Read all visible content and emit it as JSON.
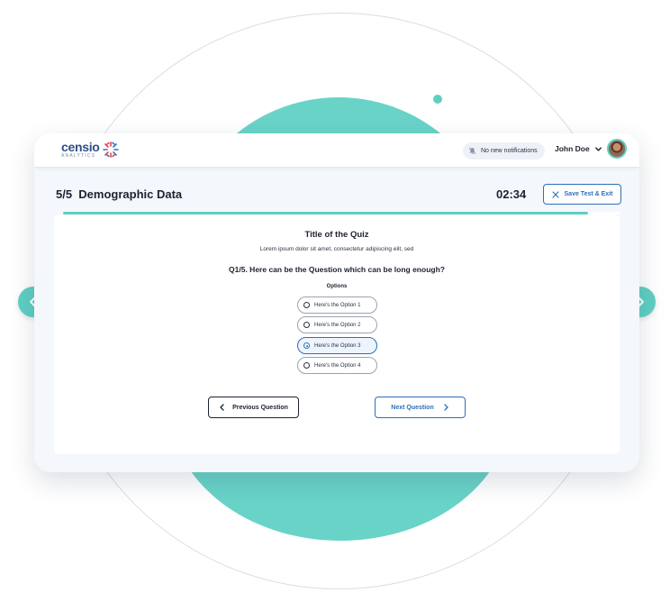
{
  "header": {
    "logo_text": "censio",
    "logo_subtext": "ANALYTICS",
    "notifications_text": "No new notifications",
    "user_name": "John Doe"
  },
  "quiz": {
    "section_title": "5/5  Demographic Data",
    "timer": "02:34",
    "save_exit_label": "Save Test & Exit",
    "progress_fraction": 0.94,
    "title": "Title of the Quiz",
    "description": "Lorem ipsum dolor sit amet, consectetur adipiscing elit, sed",
    "question": "Q1/5. Here can be the Question which can be long enough?",
    "options_label": "Options",
    "options": [
      "Here's the Option 1",
      "Here's the Option 2",
      "Here's the Option 3",
      "Here's the Option 4"
    ],
    "selected_option": "Here's the Option 3",
    "prev_label": "Previous Question",
    "next_label": "Next Question"
  },
  "colors": {
    "accent_teal": "#5fcfc2",
    "primary_blue": "#2e6fb8",
    "logo_blue": "#2e4d8a"
  },
  "icons": [
    "logo-mark-icon",
    "bell-off-icon",
    "chevron-down-icon",
    "close-icon",
    "chevron-left-icon",
    "chevron-right-icon"
  ]
}
